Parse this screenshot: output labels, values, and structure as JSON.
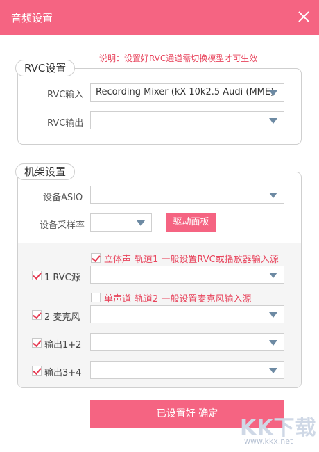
{
  "window": {
    "title": "音频设置"
  },
  "note": "说明：设置好RVC通道需切换模型才可生效",
  "rvc_group": {
    "title": "RVC设置",
    "input_label": "RVC输入",
    "input_value": "Recording Mixer (kX 10k2.5 Audi (MME)",
    "output_label": "RVC输出",
    "output_value": ""
  },
  "rack_group": {
    "title": "机架设置",
    "asio_label": "设备ASIO",
    "asio_value": "",
    "rate_label": "设备采样率",
    "rate_value": "",
    "driver_button": "驱动面板",
    "stereo": {
      "label": "立体声",
      "checked": true,
      "desc": "轨道1 一般设置RVC或播放器输入源"
    },
    "mono": {
      "label": "单声道",
      "checked": false,
      "desc": "轨道2 一般设置麦克风输入源"
    },
    "channels": [
      {
        "label": "1 RVC源",
        "checked": true,
        "value": ""
      },
      {
        "label": "2 麦克风",
        "checked": true,
        "value": ""
      },
      {
        "label": "输出1+2",
        "checked": true,
        "value": ""
      },
      {
        "label": "输出3+4",
        "checked": true,
        "value": ""
      }
    ]
  },
  "confirm_button": "已设置好 确定",
  "watermark": {
    "logo": "KK下载",
    "url": "www.kkx.net"
  },
  "colors": {
    "accent": "#f56482",
    "note_red": "#e8455d"
  }
}
